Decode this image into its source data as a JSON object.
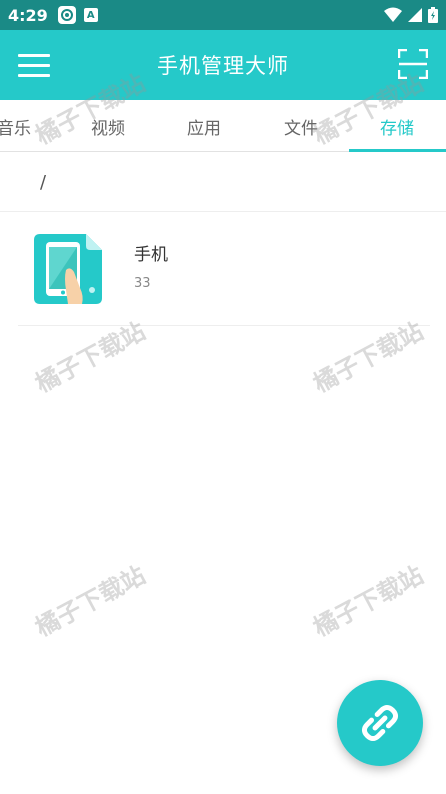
{
  "status_bar": {
    "time": "4:29",
    "notif_badge": "A"
  },
  "app_bar": {
    "title": "手机管理大师"
  },
  "tabs": [
    {
      "label": "音乐"
    },
    {
      "label": "视频"
    },
    {
      "label": "应用"
    },
    {
      "label": "文件"
    },
    {
      "label": "存储",
      "active": true
    }
  ],
  "breadcrumb": {
    "path": "/"
  },
  "storage_list": [
    {
      "name": "手机",
      "count": "33"
    }
  ],
  "watermark": {
    "text": "橘子下载站"
  },
  "colors": {
    "primary": "#25c9c9",
    "status_bar": "#1a8a86",
    "text_primary": "#333333",
    "text_secondary": "#888888"
  }
}
